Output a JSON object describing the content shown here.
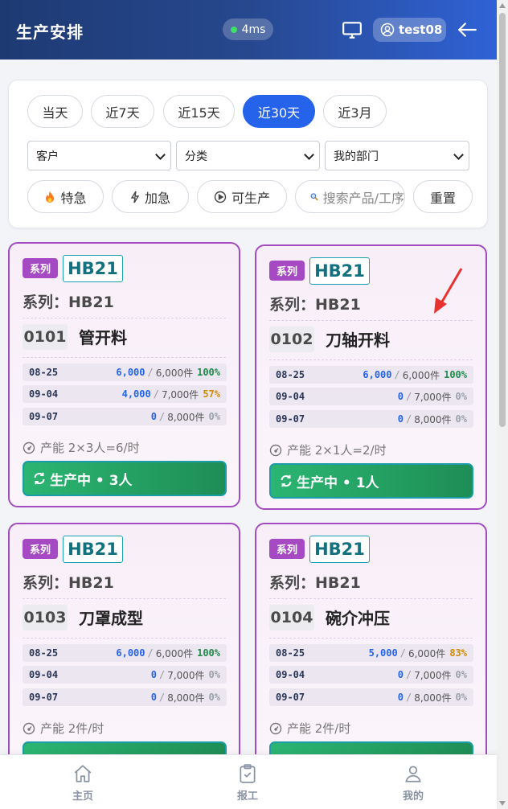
{
  "header": {
    "title": "生产安排",
    "latency": "4ms",
    "username": "test08"
  },
  "filters": {
    "ranges": [
      "当天",
      "近7天",
      "近15天",
      "近30天",
      "近3月"
    ],
    "active_range": "近30天",
    "selects": {
      "customer": "客户",
      "category": "分类",
      "department": "我的部门"
    },
    "toggles": {
      "special": "特急",
      "urgent": "加急",
      "producible": "可生产"
    },
    "search_placeholder": "搜索产品/工序",
    "reset": "重置"
  },
  "cards": [
    {
      "tag": "系列",
      "code": "HB21",
      "series": "系列：HB21",
      "proc_no": "0101",
      "proc_name": "管开料",
      "rows": [
        {
          "date": "08-25",
          "done": "6,000",
          "plan": "6,000件",
          "pct": "100%",
          "pct_color": "green"
        },
        {
          "date": "09-04",
          "done": "4,000",
          "plan": "7,000件",
          "pct": "57%",
          "pct_color": "orange"
        },
        {
          "date": "09-07",
          "done": "0",
          "plan": "8,000件",
          "pct": "0%",
          "pct_color": "gray"
        }
      ],
      "capacity": "产能 2×3人=6/时",
      "status": "生产中 • 3人"
    },
    {
      "tag": "系列",
      "code": "HB21",
      "series": "系列：HB21",
      "proc_no": "0102",
      "proc_name": "刀轴开料",
      "rows": [
        {
          "date": "08-25",
          "done": "6,000",
          "plan": "6,000件",
          "pct": "100%",
          "pct_color": "green"
        },
        {
          "date": "09-04",
          "done": "0",
          "plan": "7,000件",
          "pct": "0%",
          "pct_color": "gray"
        },
        {
          "date": "09-07",
          "done": "0",
          "plan": "8,000件",
          "pct": "0%",
          "pct_color": "gray"
        }
      ],
      "capacity": "产能 2×1人=2/时",
      "status": "生产中 • 1人"
    },
    {
      "tag": "系列",
      "code": "HB21",
      "series": "系列：HB21",
      "proc_no": "0103",
      "proc_name": "刀罩成型",
      "rows": [
        {
          "date": "08-25",
          "done": "6,000",
          "plan": "6,000件",
          "pct": "100%",
          "pct_color": "green"
        },
        {
          "date": "09-04",
          "done": "0",
          "plan": "7,000件",
          "pct": "0%",
          "pct_color": "gray"
        },
        {
          "date": "09-07",
          "done": "0",
          "plan": "8,000件",
          "pct": "0%",
          "pct_color": "gray"
        }
      ],
      "capacity": "产能 2件/时",
      "status": ""
    },
    {
      "tag": "系列",
      "code": "HB21",
      "series": "系列：HB21",
      "proc_no": "0104",
      "proc_name": "碗介冲压",
      "rows": [
        {
          "date": "08-25",
          "done": "5,000",
          "plan": "6,000件",
          "pct": "83%",
          "pct_color": "orange"
        },
        {
          "date": "09-04",
          "done": "0",
          "plan": "7,000件",
          "pct": "0%",
          "pct_color": "gray"
        },
        {
          "date": "09-07",
          "done": "0",
          "plan": "8,000件",
          "pct": "0%",
          "pct_color": "gray"
        }
      ],
      "capacity": "产能 2件/时",
      "status": ""
    }
  ],
  "nav": {
    "home": "主页",
    "report": "报工",
    "mine": "我的"
  },
  "colors": {
    "header_start": "#1e3a73",
    "header_end": "#2f62d6",
    "accent": "#2563eb",
    "card_border": "#a24cc0",
    "status_green": "#1e8e56"
  }
}
